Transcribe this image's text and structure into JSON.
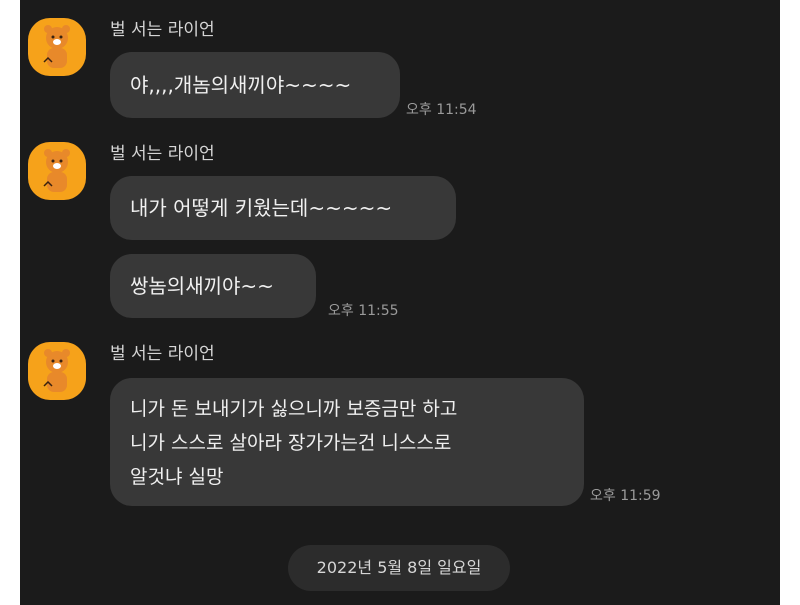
{
  "sender": {
    "name": "벌 서는 라이언",
    "avatar_icon": "ryan-character-avatar-icon"
  },
  "groups": [
    {
      "messages": [
        {
          "text": "야,,,,개놈의새끼야~~~~",
          "time": "오후 11:54"
        }
      ]
    },
    {
      "messages": [
        {
          "text": "내가  어떻게 키웠는데~~~~~",
          "time": ""
        },
        {
          "text": "쌍놈의새끼야~~",
          "time": "오후 11:55"
        }
      ]
    },
    {
      "messages": [
        {
          "lines": [
            "니가 돈 보내기가 싫으니까 보증금만 하고",
            "니가 스스로 살아라 장가가는건 니스스로",
            "알것냐  실망"
          ],
          "time": "오후 11:59"
        }
      ]
    }
  ],
  "date_divider": "2022년 5월 8일 일요일",
  "colors": {
    "background": "#1b1b1b",
    "bubble": "#383838",
    "avatar": "#f6a21a"
  }
}
